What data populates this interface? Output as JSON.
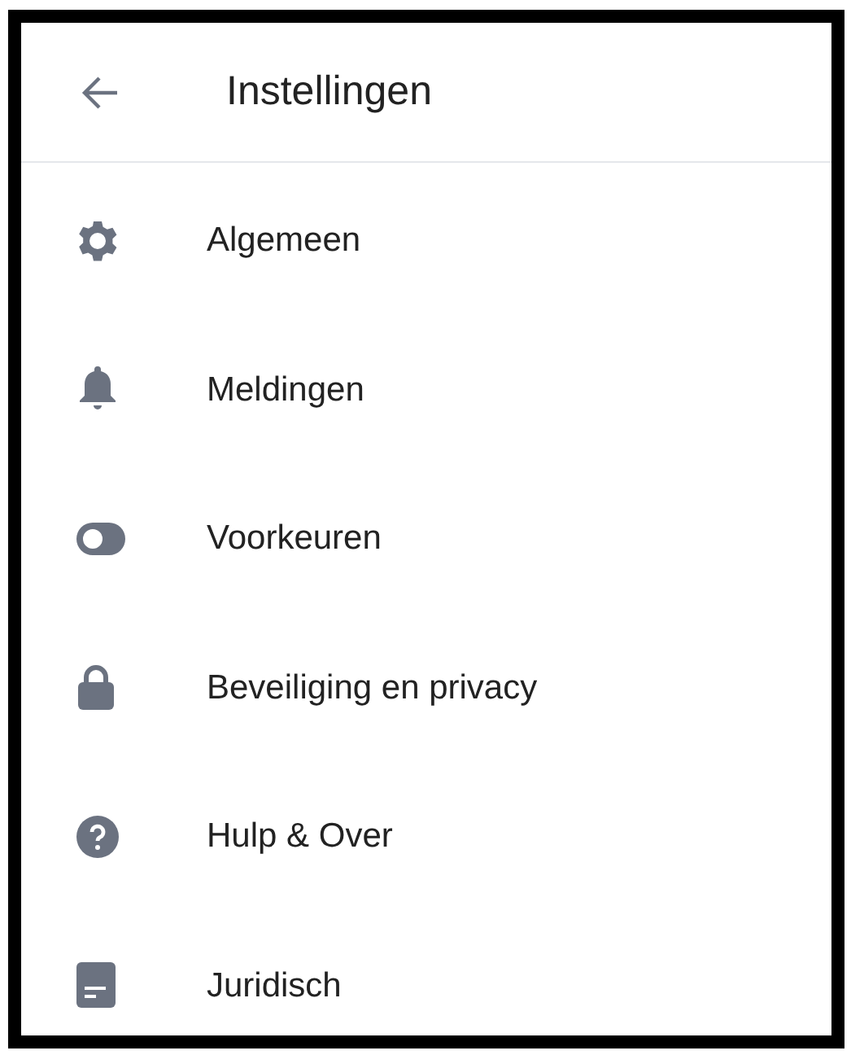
{
  "header": {
    "title": "Instellingen"
  },
  "items": [
    {
      "label": "Algemeen"
    },
    {
      "label": "Meldingen"
    },
    {
      "label": "Voorkeuren"
    },
    {
      "label": "Beveiliging en privacy"
    },
    {
      "label": "Hulp & Over"
    },
    {
      "label": "Juridisch"
    }
  ]
}
